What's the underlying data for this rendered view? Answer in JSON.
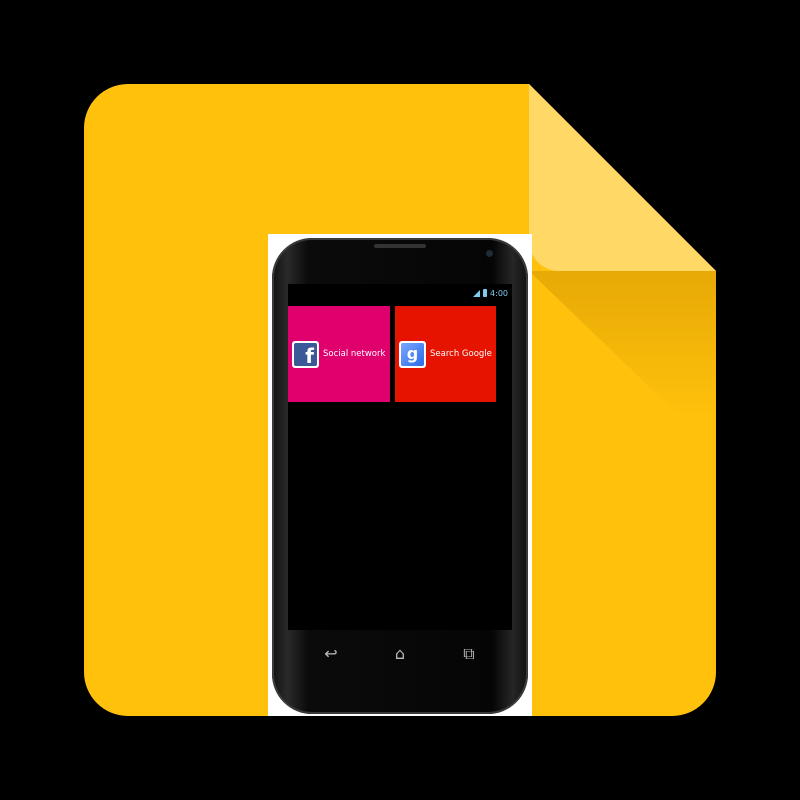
{
  "icon": {
    "background_color": "#FFC10B",
    "fold_color": "#FFD865"
  },
  "phone": {
    "status_bar": {
      "time": "4:00",
      "accent_color": "#7ECBF0"
    },
    "tiles": [
      {
        "label": "Social network",
        "icon": "facebook-icon",
        "icon_glyph": "f",
        "color": "#E0006D"
      },
      {
        "label": "Search Google",
        "icon": "google-icon",
        "icon_glyph": "g",
        "color": "#E51300"
      }
    ],
    "nav": {
      "back_icon": "back-icon",
      "home_icon": "home-icon",
      "recent_icon": "recent-apps-icon"
    }
  }
}
